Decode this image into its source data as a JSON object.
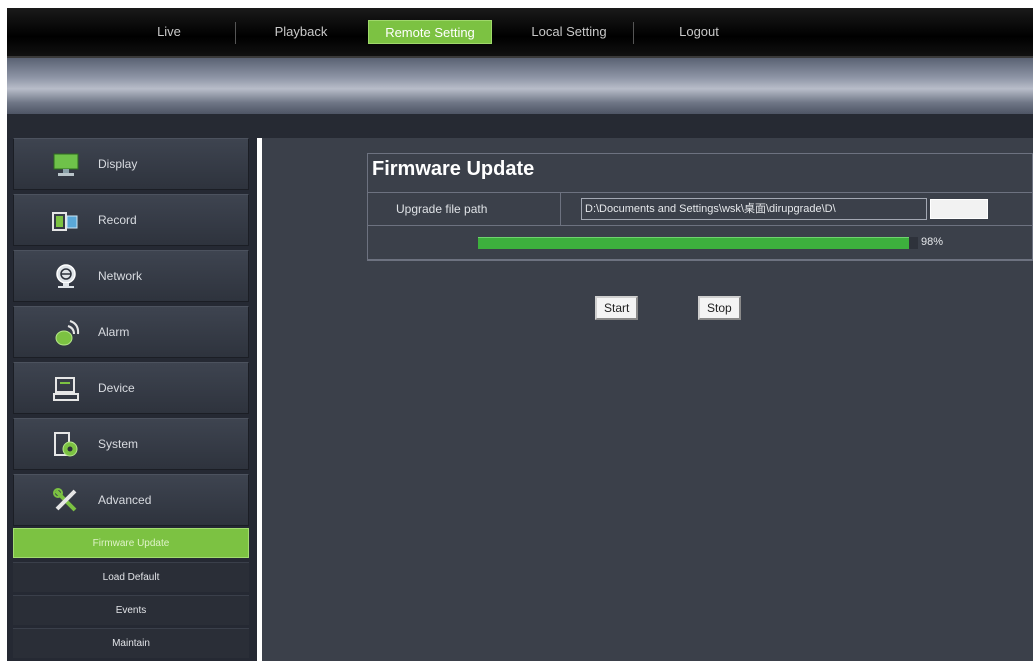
{
  "nav": {
    "items": [
      {
        "label": "Live",
        "active": false
      },
      {
        "label": "Playback",
        "active": false
      },
      {
        "label": "Remote Setting",
        "active": true
      },
      {
        "label": "Local Setting",
        "active": false
      },
      {
        "label": "Logout",
        "active": false
      }
    ]
  },
  "sidebar": {
    "items": [
      {
        "label": "Display",
        "icon": "monitor-icon"
      },
      {
        "label": "Record",
        "icon": "camera-record-icon"
      },
      {
        "label": "Network",
        "icon": "network-globe-icon"
      },
      {
        "label": "Alarm",
        "icon": "alarm-icon"
      },
      {
        "label": "Device",
        "icon": "device-icon"
      },
      {
        "label": "System",
        "icon": "system-icon"
      },
      {
        "label": "Advanced",
        "icon": "tools-icon"
      }
    ],
    "sub_items": [
      {
        "label": "Firmware Update",
        "active": true
      },
      {
        "label": "Load Default",
        "active": false
      },
      {
        "label": "Events",
        "active": false
      },
      {
        "label": "Maintain",
        "active": false
      }
    ]
  },
  "firmware": {
    "title": "Firmware Update",
    "path_label": "Upgrade file path",
    "path_value": "D:\\Documents and Settings\\wsk\\桌面\\dirupgrade\\D\\",
    "progress_percent": 98,
    "progress_text": "98%",
    "start_label": "Start",
    "stop_label": "Stop"
  },
  "colors": {
    "accent": "#7cc242",
    "progress": "#3db03d",
    "background": "#3b404a"
  }
}
